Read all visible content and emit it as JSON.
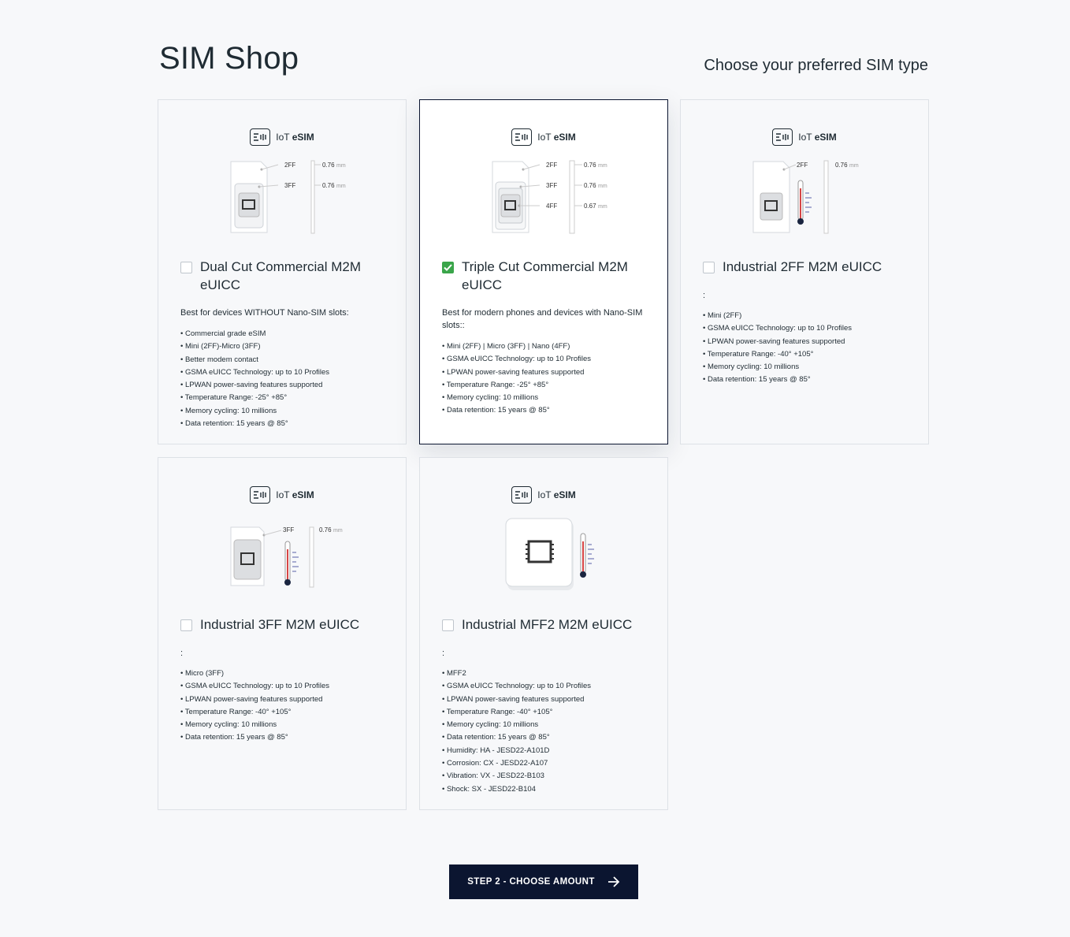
{
  "header": {
    "title": "SIM Shop",
    "subtitle": "Choose your preferred SIM type"
  },
  "brand": {
    "prefix": "IoT",
    "name": "eSIM"
  },
  "dims": {
    "unit": "mm",
    "v076": "0.76",
    "v067": "0.67",
    "l2ff": "2FF",
    "l3ff": "3FF",
    "l4ff": "4FF"
  },
  "cards": [
    {
      "title": "Dual Cut Commercial M2M eUICC",
      "checked": false,
      "description": "Best for devices WITHOUT Nano-SIM slots:",
      "features": [
        "Commercial grade eSIM",
        "Mini (2FF)-Micro (3FF)",
        "Better modem contact",
        "GSMA eUICC Technology: up to 10 Profiles",
        "LPWAN power-saving features supported",
        "Temperature Range: -25° +85°",
        "Memory cycling: 10 millions",
        "Data retention: 15 years @ 85°"
      ]
    },
    {
      "title": "Triple Cut Commercial M2M eUICC",
      "checked": true,
      "description": "Best for modern phones and devices with Nano-SIM slots::",
      "features": [
        "Mini (2FF) | Micro (3FF) | Nano (4FF)",
        "GSMA eUICC Technology: up to 10 Profiles",
        "LPWAN power-saving features supported",
        "Temperature Range: -25° +85°",
        "Memory cycling: 10 millions",
        "Data retention: 15 years @ 85°"
      ]
    },
    {
      "title": "Industrial 2FF M2M eUICC",
      "checked": false,
      "description": ":",
      "features": [
        "Mini (2FF)",
        "GSMA eUICC Technology: up to 10 Profiles",
        "LPWAN power-saving features supported",
        "Temperature Range: -40° +105°",
        "Memory cycling: 10 millions",
        "Data retention: 15 years @ 85°"
      ]
    },
    {
      "title": "Industrial 3FF M2M eUICC",
      "checked": false,
      "description": ":",
      "features": [
        "Micro (3FF)",
        "GSMA eUICC Technology: up to 10 Profiles",
        "LPWAN power-saving features supported",
        "Temperature Range: -40° +105°",
        "Memory cycling: 10 millions",
        "Data retention: 15 years @ 85°"
      ]
    },
    {
      "title": "Industrial MFF2 M2M eUICC",
      "checked": false,
      "description": ":",
      "features": [
        "MFF2",
        "GSMA eUICC Technology: up to 10 Profiles",
        "LPWAN power-saving features supported",
        "Temperature Range: -40° +105°",
        "Memory cycling: 10 millions",
        "Data retention: 15 years @ 85°",
        "Humidity: HA - JESD22-A101D",
        "Corrosion: CX - JESD22-A107",
        "Vibration: VX - JESD22-B103",
        "Shock: SX - JESD22-B104"
      ]
    }
  ],
  "cta": {
    "label": "STEP 2 - CHOOSE AMOUNT"
  },
  "icons": {
    "brand": "esim-logo-icon",
    "check": "checkmark-icon",
    "cta": "arrow-right-icon"
  },
  "colors": {
    "accent": "#0b1530",
    "check": "#3aa54a",
    "thermo": "#d64545"
  }
}
